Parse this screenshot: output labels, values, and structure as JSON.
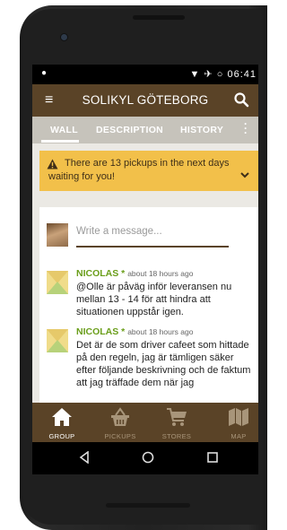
{
  "status_bar": {
    "left_icon": "notification-dot",
    "time": "06:41",
    "icons": [
      "wifi-icon",
      "airplane-icon",
      "sync-icon"
    ]
  },
  "app_bar": {
    "menu_icon": "hamburger-menu-icon",
    "title": "SOLIKYL GÖTEBORG",
    "search_icon": "search-icon"
  },
  "tabs": {
    "items": [
      {
        "label": "WALL",
        "active": true
      },
      {
        "label": "DESCRIPTION",
        "active": false
      },
      {
        "label": "HISTORY",
        "active": false
      }
    ],
    "more_icon": "more-vert-icon"
  },
  "banner": {
    "line1": "There are 13 pickups in the next days",
    "line2": "waiting for you!"
  },
  "composer": {
    "placeholder": "Write a message..."
  },
  "posts": [
    {
      "author": "NICOLAS",
      "star": "*",
      "time": "about 18 hours ago",
      "body": "@Olle är påväg inför leveransen nu mellan 13 - 14 för att hindra att situationen uppstår igen."
    },
    {
      "author": "NICOLAS",
      "star": "*",
      "time": "about 18 hours ago",
      "body": "Det är de som driver cafeet som hittade på den regeln, jag är tämligen säker efter följande beskrivning och de faktum att jag träffade dem när jag"
    }
  ],
  "bottom_nav": {
    "items": [
      {
        "label": "GROUP",
        "icon": "home-icon",
        "active": true
      },
      {
        "label": "PICKUPS",
        "icon": "basket-icon",
        "active": false
      },
      {
        "label": "STORES",
        "icon": "cart-icon",
        "active": false
      },
      {
        "label": "MAP",
        "icon": "map-icon",
        "active": false
      }
    ]
  },
  "colors": {
    "app_bar": "#5a4327",
    "tabs": "#c6c3bb",
    "banner": "#f2c04a",
    "author": "#6a9e1a"
  }
}
